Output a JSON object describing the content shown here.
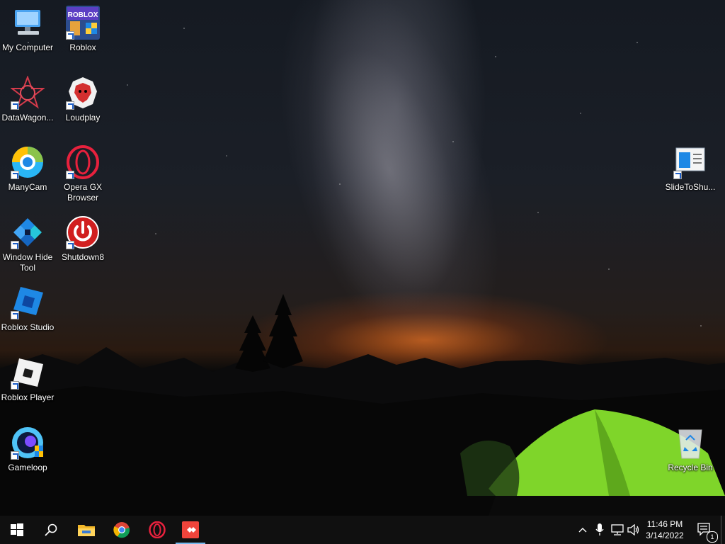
{
  "desktop_icons": {
    "my_computer": "My Computer",
    "roblox": "Roblox",
    "datawagon": "DataWagon...",
    "loudplay": "Loudplay",
    "manycam": "ManyCam",
    "opera_gx": "Opera GX Browser",
    "window_hide_tool": "Window Hide Tool",
    "shutdown8": "Shutdown8",
    "roblox_studio": "Roblox Studio",
    "roblox_player": "Roblox Player",
    "gameloop": "Gameloop",
    "slidetoshutdown": "SlideToShu...",
    "recycle_bin": "Recycle Bin"
  },
  "taskbar": {
    "pinned": [
      "start-icon",
      "search-icon",
      "file-explorer-icon",
      "chrome-icon",
      "opera-gx-icon",
      "anydesk-icon"
    ],
    "time": "11:46 PM",
    "date": "3/14/2022",
    "notification_count": "1",
    "accent": "#76b9ed"
  }
}
